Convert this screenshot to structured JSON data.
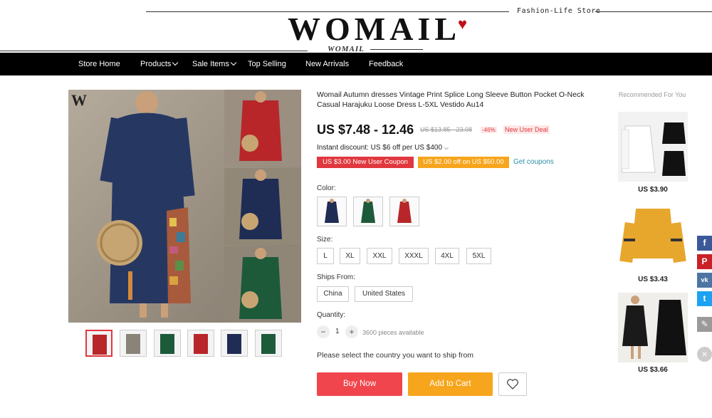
{
  "header": {
    "brand": "WOMAIL",
    "sub_brand": "WOMAIL",
    "tagline": "Fashion-Life Store"
  },
  "nav": {
    "items": [
      {
        "label": "Store Home",
        "has_caret": false
      },
      {
        "label": "Products",
        "has_caret": true
      },
      {
        "label": "Sale Items",
        "has_caret": true
      },
      {
        "label": "Top Selling",
        "has_caret": false
      },
      {
        "label": "New Arrivals",
        "has_caret": false
      },
      {
        "label": "Feedback",
        "has_caret": false
      }
    ]
  },
  "product": {
    "watermark": "W",
    "title": "Womail Autumn dresses Vintage Print Splice Long Sleeve Button Pocket O-Neck Casual Harajuku Loose Dress L-5XL Vestido Au14",
    "price": "US $7.48 - 12.46",
    "old_price": "US $13.85 - 23.08",
    "discount": "-46%",
    "new_user_deal": "New User Deal",
    "instant_discount": "Instant discount: US $6 off per US $400",
    "coupon_new_user": "US $3.00 New User Coupon",
    "coupon_off": "US $2.00 off on US $50.00",
    "get_coupons": "Get coupons",
    "color_label": "Color:",
    "colors": [
      "#1f2d55",
      "#1d5a3a",
      "#b8262a"
    ],
    "size_label": "Size:",
    "sizes": [
      "L",
      "XL",
      "XXL",
      "XXXL",
      "4XL",
      "5XL"
    ],
    "ships_label": "Ships From:",
    "ships_from": [
      "China",
      "United States"
    ],
    "quantity_label": "Quantity:",
    "quantity": "1",
    "minus": "−",
    "plus": "+",
    "available": "3600 pieces available",
    "ship_message": "Please select the country you want to ship from",
    "buy_now": "Buy Now",
    "add_to_cart": "Add to Cart",
    "thumb_colors": [
      "#b8262a",
      "#8a8378",
      "#1d5a3a",
      "#b8262a",
      "#1f2d55",
      "#1d5a3a"
    ]
  },
  "recommended": {
    "title": "Recommended For You",
    "items": [
      {
        "price": "US $3.90"
      },
      {
        "price": "US $3.43"
      },
      {
        "price": "US $3.66"
      }
    ]
  },
  "social": {
    "facebook": "f",
    "pinterest": "P",
    "vk": "vk",
    "twitter": "t",
    "edit": "✎",
    "close": "×",
    "colors": {
      "facebook": "#3b5998",
      "pinterest": "#cb2027",
      "vk": "#4c75a3",
      "twitter": "#1da1f2",
      "edit": "#9a9a9a"
    }
  }
}
